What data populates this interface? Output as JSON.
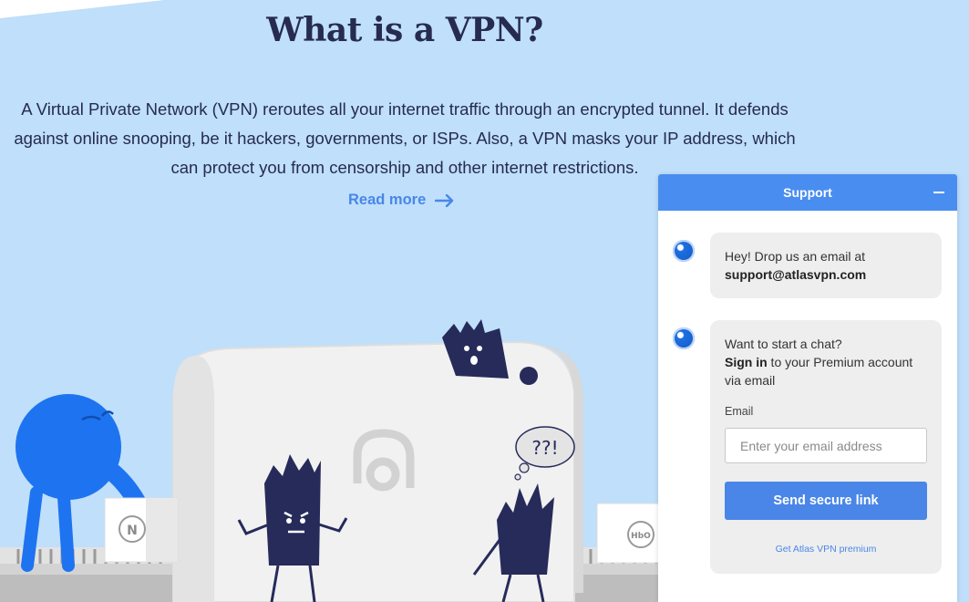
{
  "hero": {
    "title": "What is a VPN?",
    "description": "A Virtual Private Network (VPN) reroutes all your internet traffic through an encrypted tunnel. It defends against online snooping, be it hackers, governments, or ISPs. Also, a VPN masks your IP address, which can protect you from censorship and other internet restrictions.",
    "read_more_label": "Read more",
    "read_more_icon": "arrow-right-icon"
  },
  "illustration": {
    "box_left_logo": "N",
    "box_right_logo": "HbO",
    "thought_bubble_text": "??!"
  },
  "support": {
    "title": "Support",
    "minimize_icon": "minimize-icon",
    "message1": {
      "intro": "Hey! Drop us an email at",
      "email": "support@atlasvpn.com"
    },
    "message2": {
      "line1": "Want to start a chat?",
      "signin": "Sign in",
      "rest": " to your Premium account via email",
      "email_label": "Email",
      "email_placeholder": "Enter your email address",
      "email_value": "",
      "send_button": "Send secure link",
      "premium_link": "Get Atlas VPN premium"
    }
  },
  "colors": {
    "background": "#bfdffb",
    "heading": "#262b4f",
    "accent": "#4a86e8",
    "header": "#4a8df0",
    "bubble": "#eeeeee",
    "character_navy": "#262b5a",
    "character_blue": "#1e73f0"
  }
}
